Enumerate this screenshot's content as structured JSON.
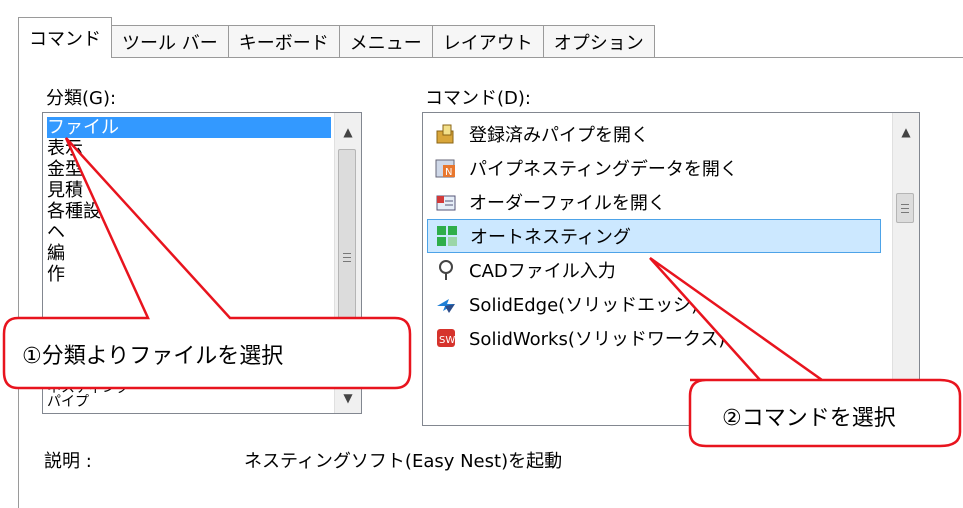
{
  "tabs": [
    "コマンド",
    "ツール バー",
    "キーボード",
    "メニュー",
    "レイアウト",
    "オプション"
  ],
  "category_label": "分類(G):",
  "command_label": "コマンド(D):",
  "categories": [
    "ファイル",
    "表示",
    "金型",
    "見積",
    "各種設定",
    "ヘ",
    "編",
    "作",
    "",
    "",
    "ネスティング",
    "パイプ"
  ],
  "commands": [
    {
      "label": "登録済みパイプを開く",
      "icon": "folder-open-icon"
    },
    {
      "label": "パイプネスティングデータを開く",
      "icon": "nesting-data-icon"
    },
    {
      "label": "オーダーファイルを開く",
      "icon": "order-file-icon"
    },
    {
      "label": "オートネスティング",
      "icon": "auto-nesting-icon"
    },
    {
      "label": "CADファイル入力",
      "icon": "cad-input-icon"
    },
    {
      "label": "SolidEdge(ソリッドエッジ)",
      "icon": "solidedge-icon"
    },
    {
      "label": "SolidWorks(ソリッドワークス)",
      "icon": "solidworks-icon"
    }
  ],
  "description_label": "説明 :",
  "description_text": "ネスティングソフト(Easy Nest)を起動",
  "callouts": {
    "one": "①分類よりファイルを選択",
    "two": "②コマンドを選択"
  },
  "colors": {
    "selection_blue": "#3399ff",
    "command_selection": "#cce8ff",
    "callout_border": "#e8141e"
  }
}
